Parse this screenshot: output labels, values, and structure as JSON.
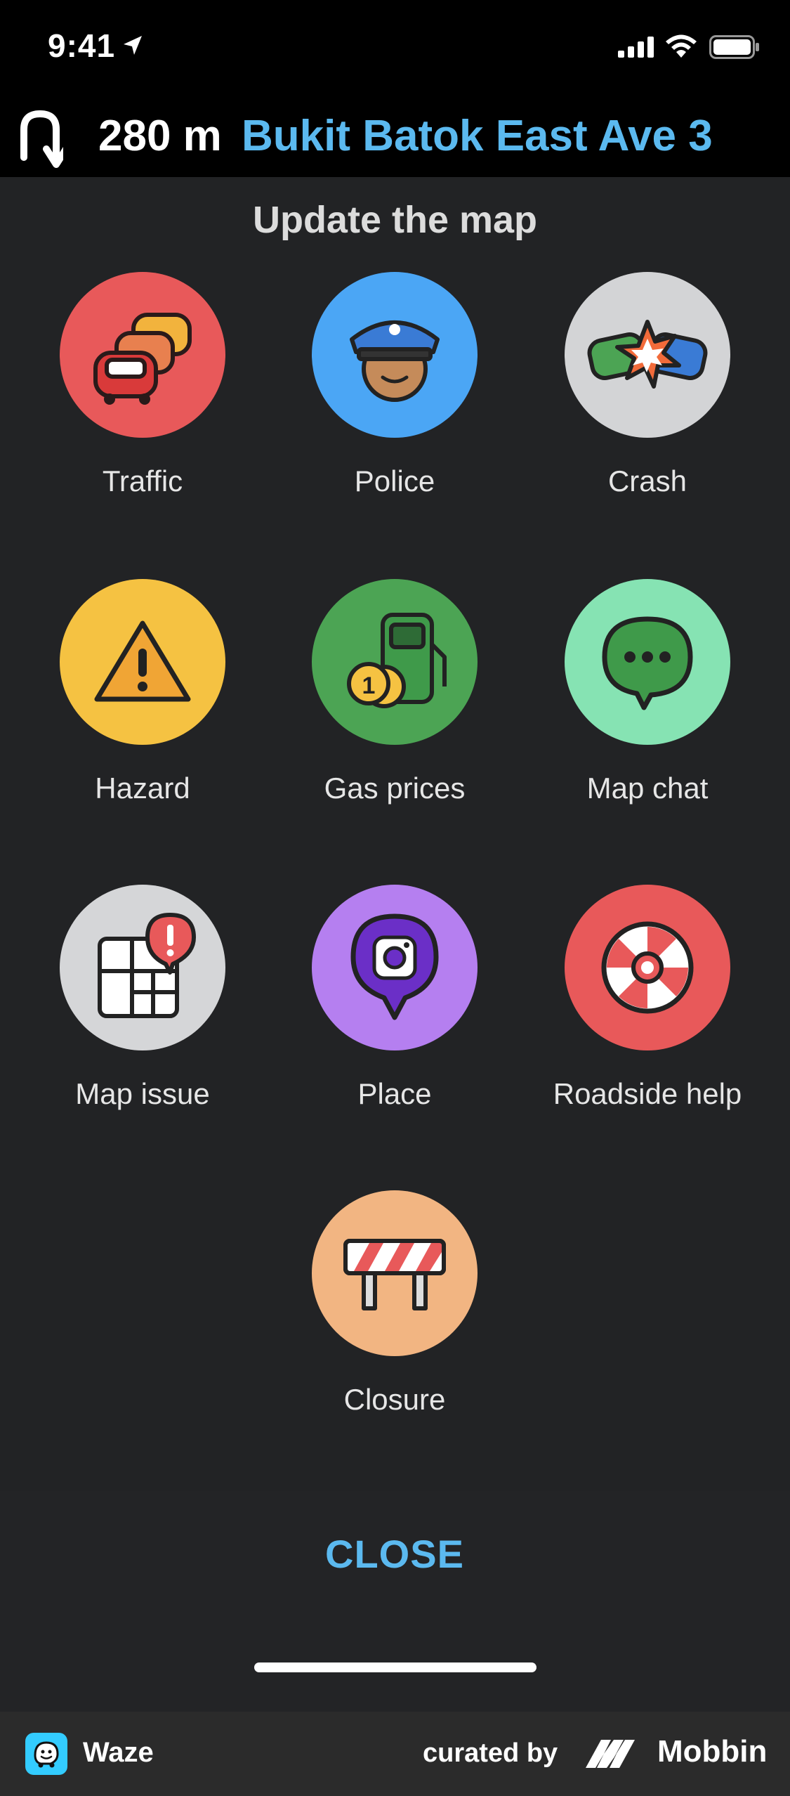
{
  "status_bar": {
    "time": "9:41"
  },
  "navigation": {
    "distance": "280 m",
    "street": "Bukit Batok East Ave 3"
  },
  "sheet": {
    "title": "Update the map",
    "items": [
      {
        "label": "Traffic",
        "icon": "traffic-icon",
        "color": "#e8595a"
      },
      {
        "label": "Police",
        "icon": "police-icon",
        "color": "#4ba6f5"
      },
      {
        "label": "Crash",
        "icon": "crash-icon",
        "color": "#d3d4d6"
      },
      {
        "label": "Hazard",
        "icon": "hazard-icon",
        "color": "#f5c242"
      },
      {
        "label": "Gas prices",
        "icon": "gas-station-icon",
        "color": "#4ca454"
      },
      {
        "label": "Map chat",
        "icon": "chat-bubble-icon",
        "color": "#86e3b3"
      },
      {
        "label": "Map issue",
        "icon": "map-issue-icon",
        "color": "#d5d6d8"
      },
      {
        "label": "Place",
        "icon": "place-camera-icon",
        "color": "#b57ff0"
      },
      {
        "label": "Roadside help",
        "icon": "lifebuoy-icon",
        "color": "#e8595a"
      },
      {
        "label": "Closure",
        "icon": "road-barrier-icon",
        "color": "#f2b582"
      }
    ],
    "close_label": "CLOSE"
  },
  "footer": {
    "app_name": "Waze",
    "curated_by": "curated by",
    "brand": "Mobbin"
  }
}
